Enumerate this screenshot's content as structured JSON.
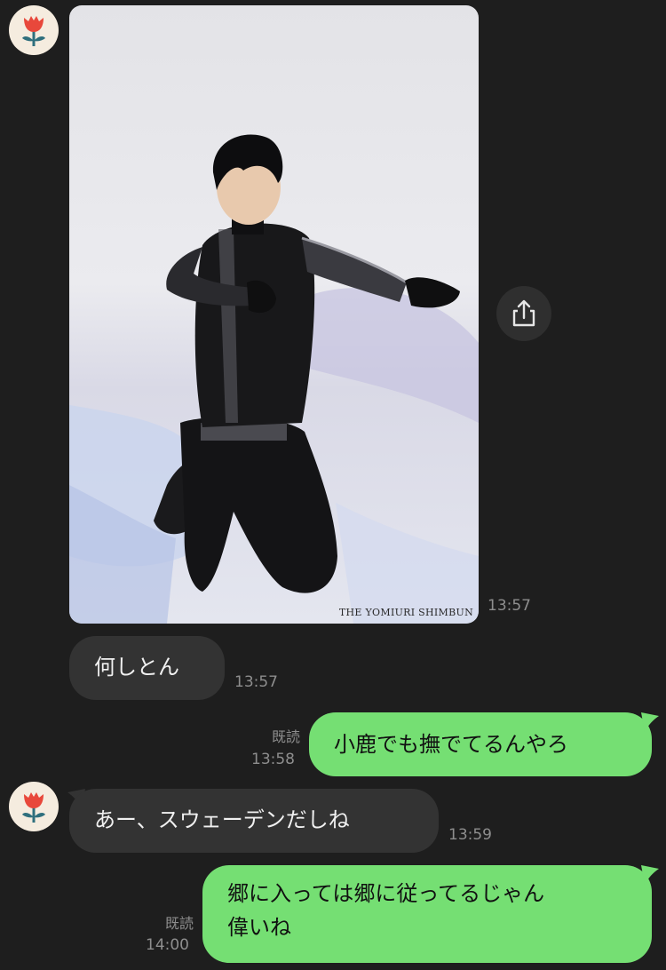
{
  "chat": {
    "photo": {
      "watermark": "THE YOMIURI SHIMBUN",
      "time": "13:57"
    },
    "messages": [
      {
        "text": "何しとん",
        "time": "13:57"
      },
      {
        "text": "小鹿でも撫でてるんやろ",
        "read": "既読",
        "time": "13:58"
      },
      {
        "text": "あー、スウェーデンだしね",
        "time": "13:59"
      },
      {
        "line1": "郷に入っては郷に従ってるじゃん",
        "line2": "偉いね",
        "read": "既読",
        "time": "14:00"
      }
    ]
  },
  "icons": {
    "avatar": "tulip-icon",
    "share": "share-icon"
  },
  "colors": {
    "background": "#1e1e1e",
    "incoming_bubble": "#333333",
    "outgoing_bubble": "#75df73",
    "timestamp": "#8e8e8e",
    "avatar_bg": "#f5ecdf",
    "flower_red": "#e8483b",
    "flower_stem": "#2f6f7d"
  }
}
